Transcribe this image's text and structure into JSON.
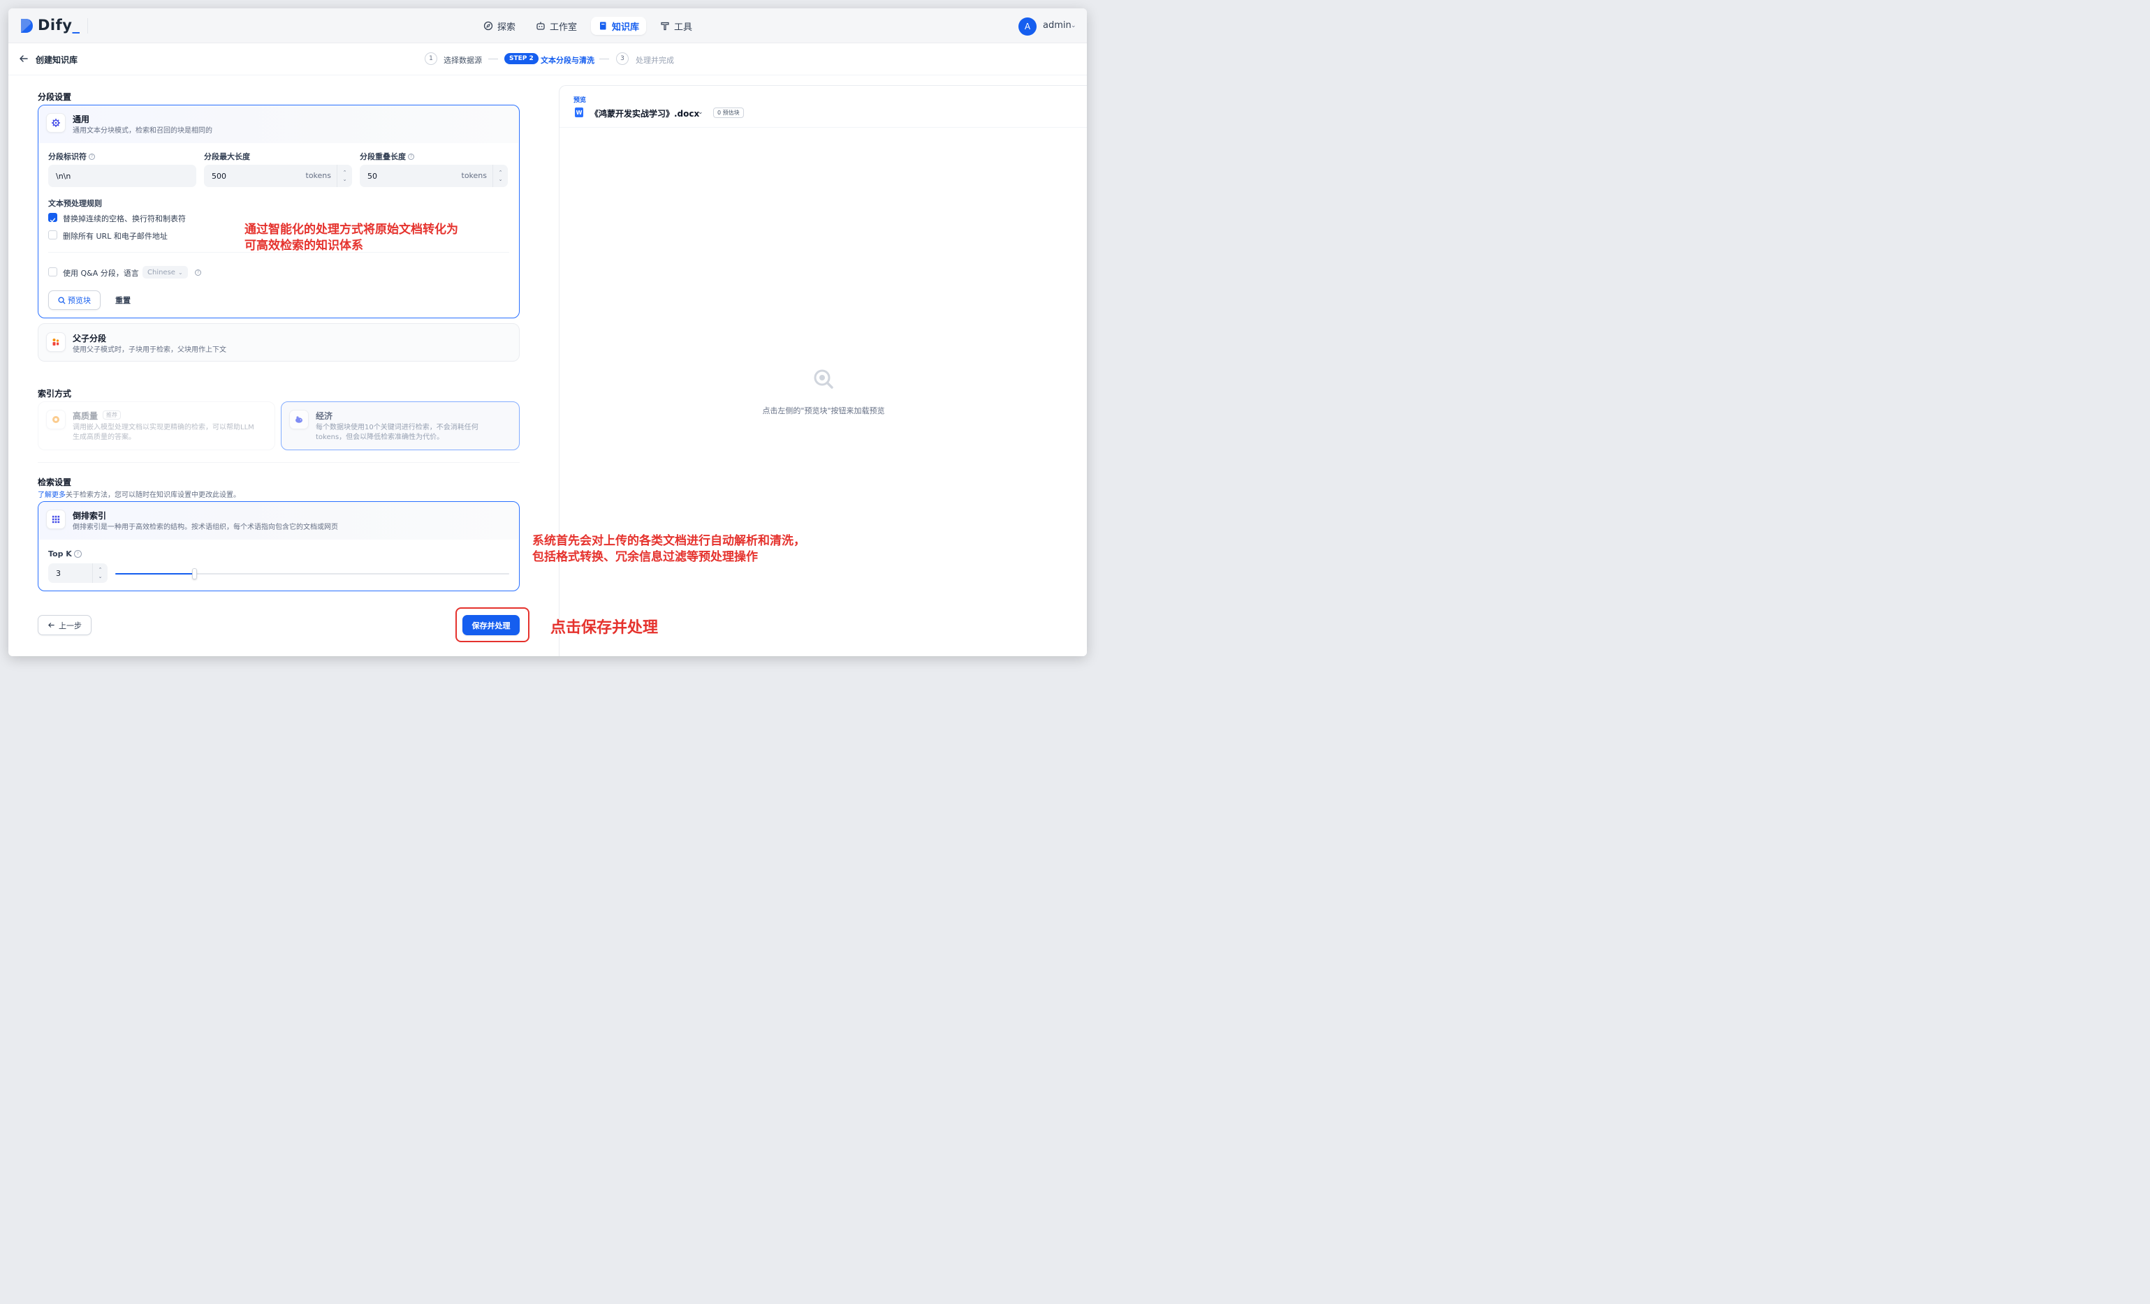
{
  "app": {
    "logo_text": "Dify",
    "logo_dot": ".",
    "nav": [
      {
        "label": "探索",
        "icon": "compass-icon"
      },
      {
        "label": "工作室",
        "icon": "robot-icon"
      },
      {
        "label": "知识库",
        "icon": "book-icon",
        "active": true
      },
      {
        "label": "工具",
        "icon": "hammer-icon"
      }
    ],
    "user": {
      "avatar_letter": "A",
      "name": "admin"
    }
  },
  "stepbar": {
    "page_title": "创建知识库",
    "steps": [
      {
        "num": "1",
        "label": "选择数据源"
      },
      {
        "num": "STEP 2",
        "label": "文本分段与清洗",
        "active": true
      },
      {
        "num": "3",
        "label": "处理并完成"
      }
    ]
  },
  "segment": {
    "section_title": "分段设置",
    "general": {
      "title": "通用",
      "desc": "通用文本分块模式，检索和召回的块是相同的",
      "delimiter_label": "分段标识符",
      "delimiter_value": "\\n\\n",
      "max_len_label": "分段最大长度",
      "max_len_value": "500",
      "overlap_label": "分段重叠长度",
      "overlap_value": "50",
      "unit": "tokens",
      "rules_title": "文本预处理规则",
      "rule_1": "替换掉连续的空格、换行符和制表符",
      "rule_1_checked": true,
      "rule_2": "删除所有 URL 和电子邮件地址",
      "rule_2_checked": false,
      "qa_label": "使用 Q&A 分段，语言",
      "qa_lang": "Chinese",
      "preview_btn": "预览块",
      "reset_btn": "重置"
    },
    "parent_child": {
      "title": "父子分段",
      "desc": "使用父子模式时，子块用于检索，父块用作上下文"
    }
  },
  "index": {
    "section_title": "索引方式",
    "high": {
      "title": "高质量",
      "badge": "推荐",
      "desc_1": "调用嵌入模型处理文档以实现更精确的检索，可以帮助LLM",
      "desc_2": "生成高质量的答案。"
    },
    "economy": {
      "title": "经济",
      "desc_1": "每个数据块使用10个关键词进行检索，不会消耗任何",
      "desc_2": "tokens，但会以降低检索准确性为代价。"
    }
  },
  "retrieval": {
    "section_title": "检索设置",
    "link_text": "了解更多",
    "hint": "关于检索方法，您可以随时在知识库设置中更改此设置。",
    "inverted": {
      "title": "倒排索引",
      "desc": "倒排索引是一种用于高效检索的结构。按术语组织，每个术语指向包含它的文档或网页"
    },
    "topk_label": "Top K",
    "topk_value": "3",
    "topk_level_fraction": 0.2
  },
  "footer": {
    "prev_btn": "上一步",
    "save_btn": "保存并处理"
  },
  "preview": {
    "label": "预览",
    "doc_name": "《鸿蒙开发实战学习》.docx",
    "seg_count": "0 预估块",
    "empty_text": "点击左侧的\"预览块\"按钮来加载预览"
  },
  "annotations": {
    "a1_line1": "通过智能化的处理方式将原始文档转化为",
    "a1_line2": "可高效检索的知识体系",
    "a2_line1": "系统首先会对上传的各类文档进行自动解析和清洗，",
    "a2_line2": "包括格式转换、冗余信息过滤等预处理操作",
    "a3": "点击保存并处理"
  },
  "colors": {
    "accent": "#155eef",
    "annotation": "#e5322d"
  }
}
